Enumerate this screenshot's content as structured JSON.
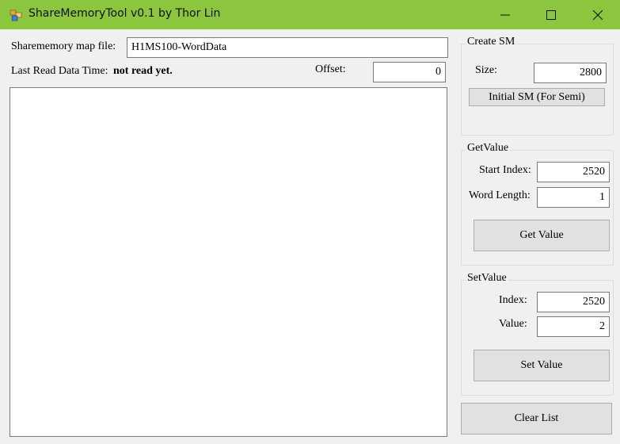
{
  "window": {
    "title": "ShareMemoryTool v0.1 by Thor Lin"
  },
  "main": {
    "map_file_label": "Sharememory map file:",
    "map_file_value": "H1MS100-WordData",
    "last_read_label": "Last Read Data Time:",
    "last_read_value": "not read yet.",
    "offset_label": "Offset:",
    "offset_value": "0"
  },
  "create_sm": {
    "title": "Create SM",
    "size_label": "Size:",
    "size_value": "2800",
    "button": "Initial SM (For Semi)"
  },
  "get_value": {
    "title": "GetValue",
    "start_index_label": "Start Index:",
    "start_index_value": "2520",
    "word_length_label": "Word Length:",
    "word_length_value": "1",
    "button": "Get Value"
  },
  "set_value": {
    "title": "SetValue",
    "index_label": "Index:",
    "index_value": "2520",
    "value_label": "Value:",
    "value_value": "2",
    "button": "Set Value"
  },
  "clear_button": "Clear List",
  "colors": {
    "titlebar": "#8cc63f",
    "window_bg": "#f0f0f0"
  },
  "icons": [
    "app-icon",
    "minimize-icon",
    "maximize-icon",
    "close-icon"
  ]
}
